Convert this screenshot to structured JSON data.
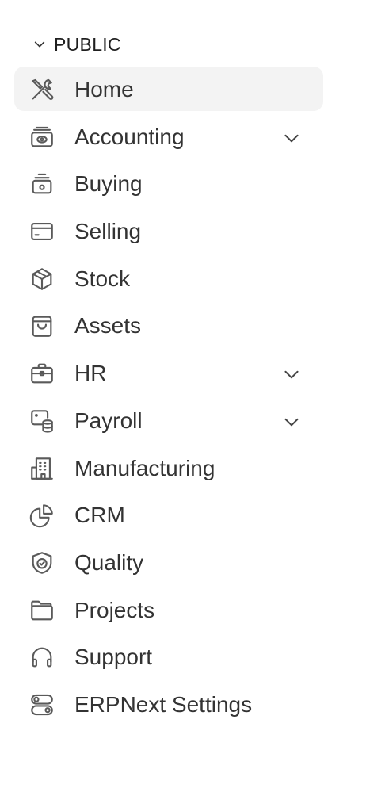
{
  "section": {
    "title": "PUBLIC",
    "expanded": true
  },
  "nav": {
    "items": [
      {
        "label": "Home",
        "icon": "tools-icon",
        "active": true,
        "has_children": false
      },
      {
        "label": "Accounting",
        "icon": "money-icon",
        "active": false,
        "has_children": true
      },
      {
        "label": "Buying",
        "icon": "register-icon",
        "active": false,
        "has_children": false
      },
      {
        "label": "Selling",
        "icon": "card-icon",
        "active": false,
        "has_children": false
      },
      {
        "label": "Stock",
        "icon": "box-icon",
        "active": false,
        "has_children": false
      },
      {
        "label": "Assets",
        "icon": "bag-icon",
        "active": false,
        "has_children": false
      },
      {
        "label": "HR",
        "icon": "briefcase-icon",
        "active": false,
        "has_children": true
      },
      {
        "label": "Payroll",
        "icon": "payroll-icon",
        "active": false,
        "has_children": true
      },
      {
        "label": "Manufacturing",
        "icon": "building-icon",
        "active": false,
        "has_children": false
      },
      {
        "label": "CRM",
        "icon": "pie-chart-icon",
        "active": false,
        "has_children": false
      },
      {
        "label": "Quality",
        "icon": "shield-check-icon",
        "active": false,
        "has_children": false
      },
      {
        "label": "Projects",
        "icon": "folder-icon",
        "active": false,
        "has_children": false
      },
      {
        "label": "Support",
        "icon": "headset-icon",
        "active": false,
        "has_children": false
      },
      {
        "label": "ERPNext Settings",
        "icon": "toggles-icon",
        "active": false,
        "has_children": false
      }
    ]
  },
  "colors": {
    "active_bg": "#f3f3f3",
    "text": "#333333",
    "icon": "#5a5a5a"
  }
}
